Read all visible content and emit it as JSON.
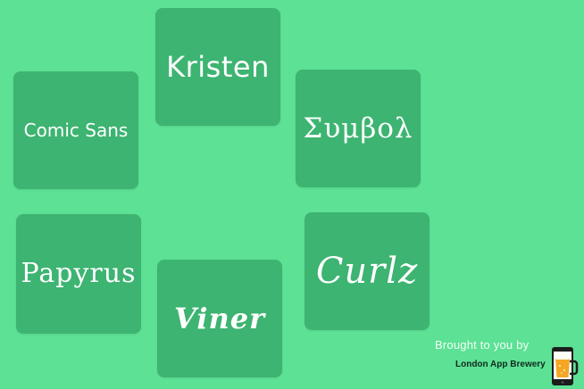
{
  "tiles": [
    {
      "id": "kristen",
      "label": "Kristen"
    },
    {
      "id": "comic",
      "label": "Comic Sans"
    },
    {
      "id": "symbol",
      "label": "Συμβολ"
    },
    {
      "id": "papyrus",
      "label": "Papyrus"
    },
    {
      "id": "curlz",
      "label": "Curlz"
    },
    {
      "id": "viner",
      "label": "Viner"
    }
  ],
  "credit": {
    "text": "Brought to you by",
    "brand": "London App Brewery",
    "logo_icon": "beer-mug-icon"
  },
  "colors": {
    "background": "#5de195",
    "tile": "#3db471",
    "text": "#ffffff"
  }
}
